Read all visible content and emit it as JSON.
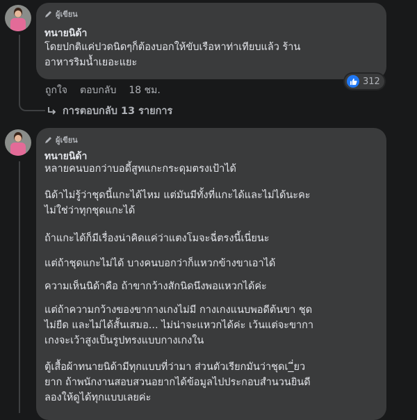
{
  "colors": {
    "background": "#18191a",
    "bubble": "#3a3b3c",
    "text": "#e4e6eb",
    "muted": "#b0b3b8",
    "like_blue": "#2078f4"
  },
  "icons": {
    "author_badge": "pencil-icon",
    "like_reaction": "thumbs-up-icon",
    "replies": "reply-arrow-icon"
  },
  "comment1": {
    "badge": "ผู้เขียน",
    "author": "ทนายนิด้า",
    "lines": [
      "โดยปกติแค่ปวดนิดๆก็ต้องบอกให้ขับเรือหาท่าเทียบแล้ว ร้าน",
      "อาหารริมน้ำเยอะแยะ"
    ],
    "actions": {
      "like": "ถูกใจ",
      "reply": "ตอบกลับ",
      "time": "18 ชม."
    },
    "reaction_count": "312",
    "replies_label": "การตอบกลับ 13 รายการ"
  },
  "comment2": {
    "badge": "ผู้เขียน",
    "author": "ทนายนิด้า",
    "paragraphs": [
      [
        "หลายคนบอกว่าบอดี้สูทแกะกระดุมตรงเป้าได้"
      ],
      [
        "นิด้าไม่รู้ว่าชุดนี้แกะได้ไหม แต่มันมีทั้งที่แกะได้และไม่ได้นะคะ",
        "ไม่ใช่ว่าทุกชุดแกะได้"
      ],
      [
        "ถ้าแกะได้ก็มีเรื่องน่าคิดแค่ว่าแตงโมจะฉี่ตรงนี้เนี่ยนะ"
      ],
      [
        "แต่ถ้าชุดแกะไม่ได้ บางคนบอกว่าก็แหวกข้างขาเอาได้"
      ],
      [
        "ความเห็นนิด้าคือ ถ้าขากว้างสักนิดนึงพอแหวกได้ค่ะ"
      ],
      [
        "แต่ถ้าความกว้างของขากางเกงไม่มี กางเกงแนบพอดีต้นขา ชุด",
        "ไม่ยืด และไม่ได้สั้นเสมอ... ไม่น่าจะแหวกได้ค่ะ เว้นแต่จะขากา",
        "เกงจะเว้าสูงเป็นรูปทรงแบบกางเกงใน"
      ],
      [
        "ตู้เสื้อผ้าทนายนิด้ามีทุกแบบที่ว่ามา ส่วนตัวเรียกมันว่าชุดเ_ี่ยว",
        "ยาก ถ้าพนักงานสอบสวนอยากได้ข้อมูลไปประกอบสำนวนยินดี",
        "ลองให้ดูได้ทุกแบบเลยค่ะ"
      ]
    ]
  }
}
